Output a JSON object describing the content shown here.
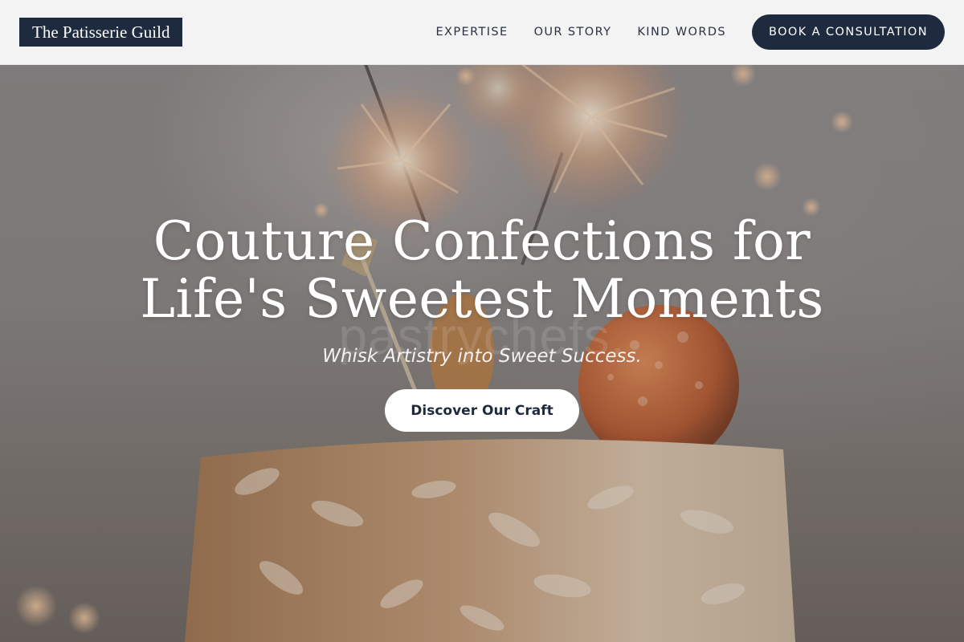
{
  "header": {
    "logo": "The Patisserie Guild",
    "nav": [
      {
        "label": "EXPERTISE"
      },
      {
        "label": "OUR STORY"
      },
      {
        "label": "KIND WORDS"
      }
    ],
    "cta_label": "BOOK A CONSULTATION"
  },
  "hero": {
    "title_line1": "Couture Confections for",
    "title_line2": "Life's Sweetest Moments",
    "tagline": "Whisk Artistry into Sweet Success.",
    "cta_label": "Discover Our Craft",
    "background_watermark": "pastrychefs."
  },
  "colors": {
    "navy": "#1e2a3d",
    "header_bg": "#f3f3f3",
    "white": "#ffffff"
  }
}
